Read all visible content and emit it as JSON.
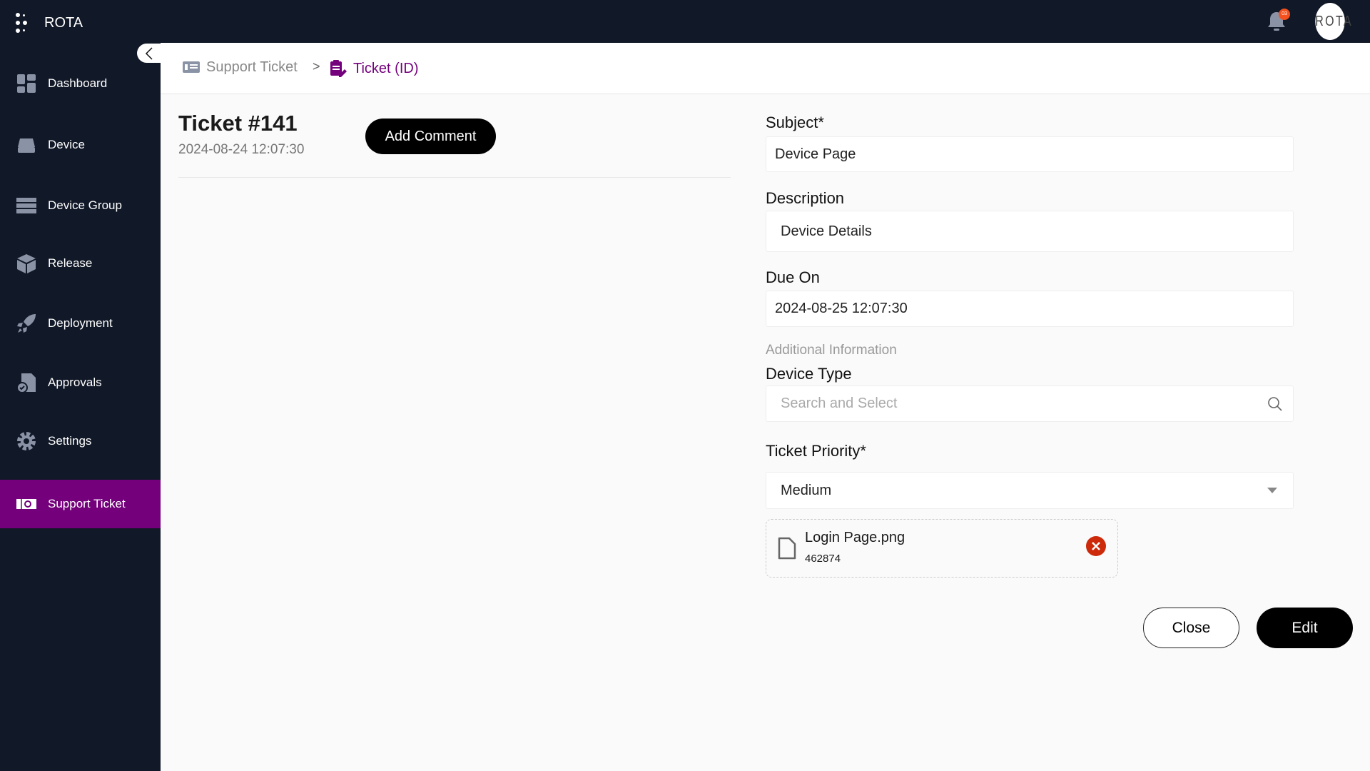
{
  "app": {
    "title": "ROTA",
    "avatar_text": "ROTA",
    "notification_count": "03"
  },
  "sidebar": {
    "items": [
      {
        "label": "Dashboard",
        "icon": "dashboard-icon"
      },
      {
        "label": "Device",
        "icon": "device-icon"
      },
      {
        "label": "Device Group",
        "icon": "server-icon"
      },
      {
        "label": "Release",
        "icon": "box-icon"
      },
      {
        "label": "Deployment",
        "icon": "rocket-icon"
      },
      {
        "label": "Approvals",
        "icon": "approval-document-icon"
      },
      {
        "label": "Settings",
        "icon": "gear-icon"
      },
      {
        "label": "Support Ticket",
        "icon": "ticket-icon",
        "active": true
      }
    ],
    "active_color": "#74007c"
  },
  "breadcrumb": {
    "items": [
      "Support Ticket",
      "Ticket (ID)"
    ],
    "separator": ">"
  },
  "ticket": {
    "title": "Ticket #141",
    "created": "2024-08-24 12:07:30",
    "add_comment": "Add Comment"
  },
  "form": {
    "subject": {
      "label": "Subject*",
      "value": "Device Page"
    },
    "description": {
      "label": "Description",
      "value": "Device Details"
    },
    "due_on": {
      "label": "Due On",
      "value": "2024-08-25 12:07:30"
    },
    "additional_info": "Additional Information",
    "device_type": {
      "label": "Device Type",
      "placeholder": "Search and Select"
    },
    "priority": {
      "label": "Ticket Priority*",
      "value": "Medium"
    },
    "attachment": {
      "name": "Login Page.png",
      "size": "462874"
    }
  },
  "actions": {
    "close": "Close",
    "edit": "Edit"
  }
}
